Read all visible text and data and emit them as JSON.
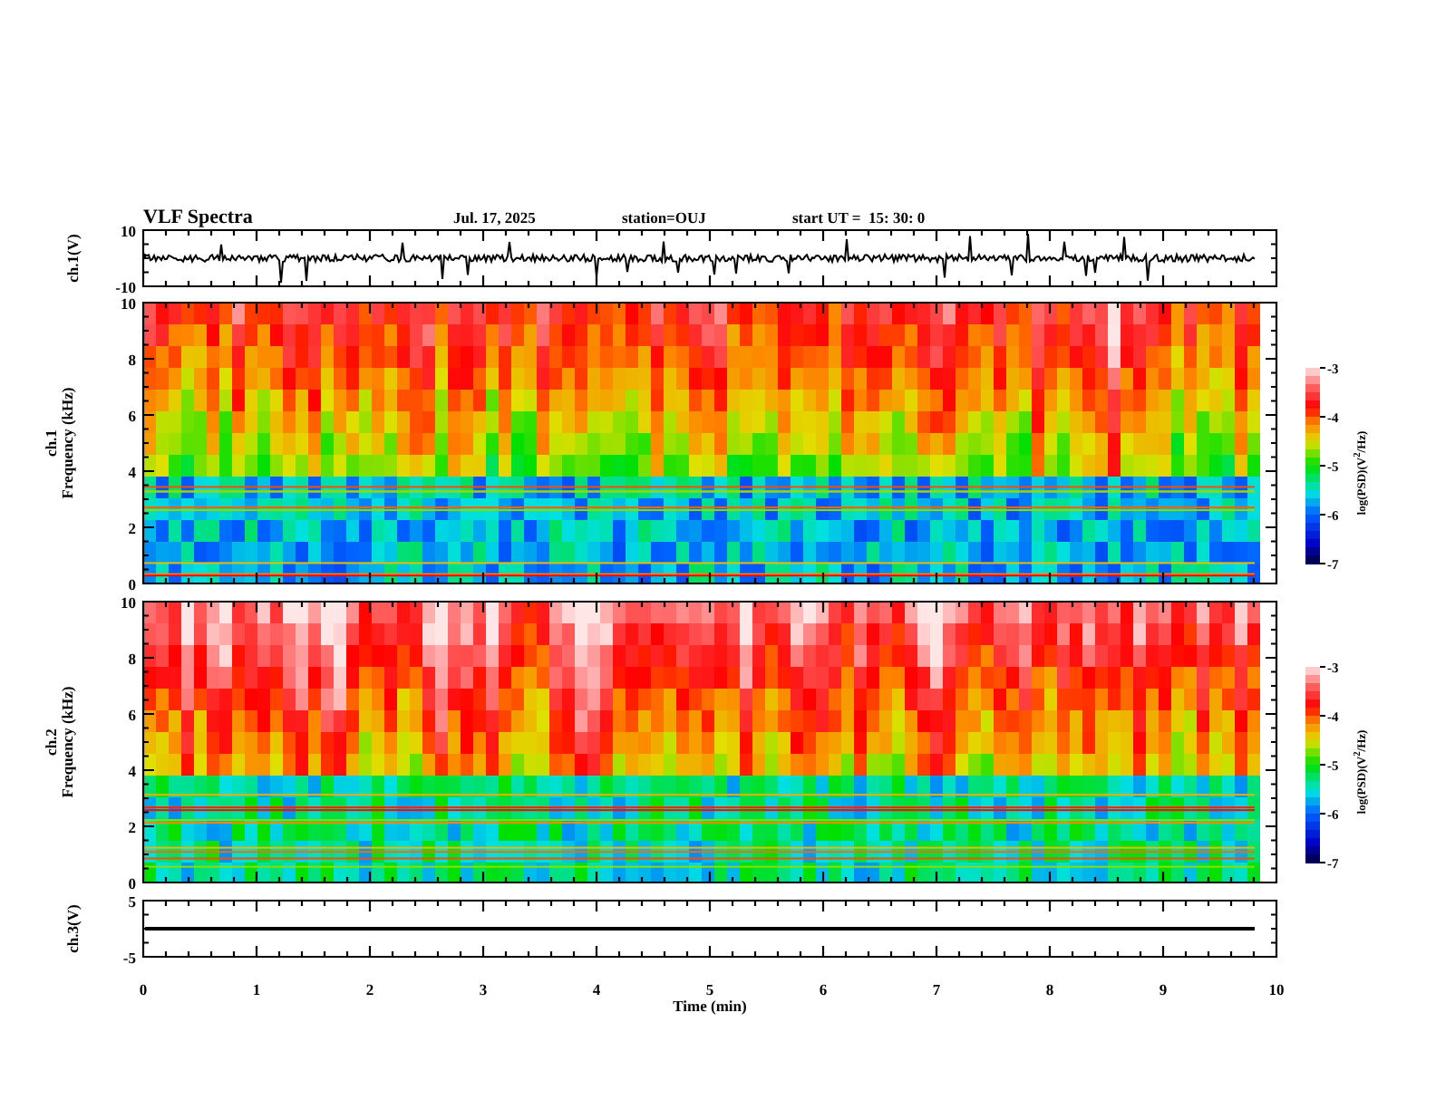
{
  "header": {
    "title": "VLF Spectra",
    "date": "Jul. 17, 2025",
    "station": "station=OUJ",
    "start_time": "start UT =  15: 30: 0"
  },
  "panels": [
    {
      "kind": "noise",
      "ylabel": "ch.1(V)",
      "yticks": [
        "10",
        "-10"
      ]
    },
    {
      "kind": "spectrogram",
      "channel": "ch.1",
      "ylabel": "Frequency (kHz)",
      "yticks": [
        "10",
        "8",
        "6",
        "4",
        "2",
        "0"
      ],
      "colorbar": {
        "ticks": [
          "-3",
          "-4",
          "-5",
          "-6",
          "-7"
        ],
        "label": "log(PSD)(V$^{2}$/Hz)"
      }
    },
    {
      "kind": "spectrogram",
      "channel": "ch.2",
      "ylabel": "Frequency (kHz)",
      "yticks": [
        "10",
        "8",
        "6",
        "4",
        "2",
        "0"
      ],
      "colorbar": {
        "ticks": [
          "-3",
          "-4",
          "-5",
          "-6",
          "-7"
        ],
        "label": "log(PSD)(V$^{2}$/Hz)"
      }
    },
    {
      "kind": "flat",
      "ylabel": "ch.3(V)",
      "yticks": [
        "5",
        "-5"
      ]
    }
  ],
  "x_axis": {
    "label": "Time (min)",
    "ticks": [
      "0",
      "1",
      "2",
      "3",
      "4",
      "5",
      "6",
      "7",
      "8",
      "9",
      "10"
    ]
  }
}
